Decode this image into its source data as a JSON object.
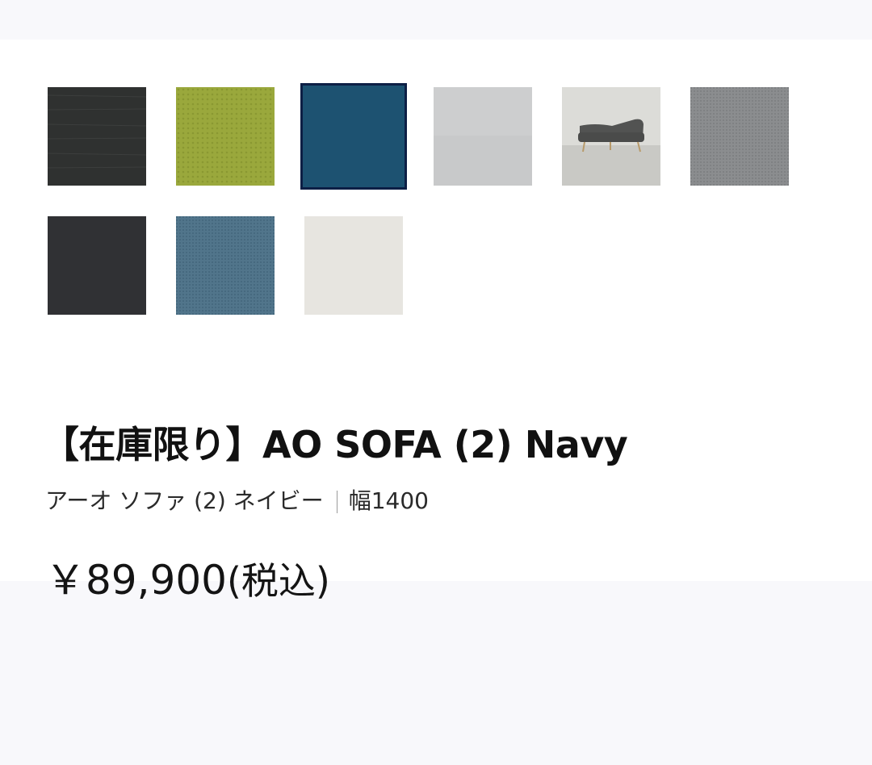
{
  "product": {
    "title": "【在庫限り】AO SOFA (2) Navy",
    "subtitle_name": "アーオ ソファ (2) ネイビー",
    "subtitle_size": "幅1400",
    "price": "￥89,900",
    "price_tax": "(税込)"
  },
  "swatches": [
    {
      "name": "charcoal-fabric",
      "color": "#2e302f",
      "selected": false
    },
    {
      "name": "green-fabric",
      "color": "#9aa83c",
      "selected": false
    },
    {
      "name": "navy-fabric",
      "color": "#1f5676",
      "selected": true
    },
    {
      "name": "light-gray-fabric",
      "color": "#c7c8c9",
      "selected": false
    },
    {
      "name": "sofa-photo",
      "color": "#d8d8d4",
      "selected": false
    },
    {
      "name": "gray-fabric",
      "color": "#8a8c8e",
      "selected": false
    },
    {
      "name": "black-fabric",
      "color": "#2b2d30",
      "selected": false
    },
    {
      "name": "blue-gray-fabric",
      "color": "#4f7389",
      "selected": false
    },
    {
      "name": "off-white-fabric",
      "color": "#e6e4df",
      "selected": false
    }
  ]
}
